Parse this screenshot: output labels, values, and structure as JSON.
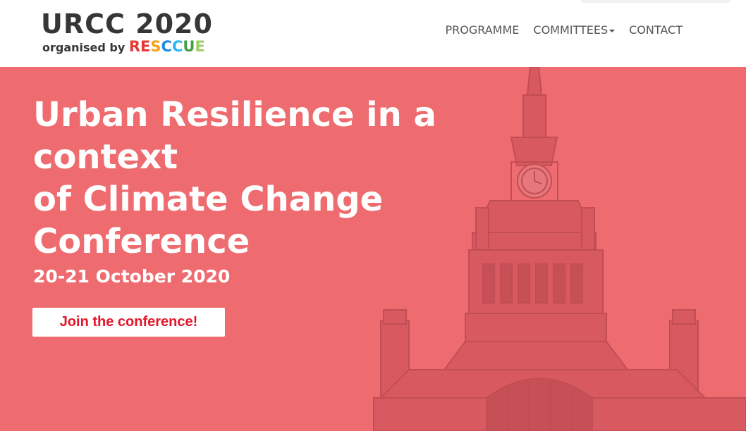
{
  "logo": {
    "title": "URCC 2020",
    "subtitle": "organised by",
    "brand_letters": [
      {
        "char": "R",
        "color": "#e53935"
      },
      {
        "char": "E",
        "color": "#e53935"
      },
      {
        "char": "S",
        "color": "#f4a21b"
      },
      {
        "char": "C",
        "color": "#1e88e5"
      },
      {
        "char": "C",
        "color": "#29b6f6"
      },
      {
        "char": "U",
        "color": "#43a047"
      },
      {
        "char": "E",
        "color": "#9ccc65"
      }
    ]
  },
  "nav": {
    "items": [
      {
        "label": "PROGRAMME",
        "has_dropdown": false
      },
      {
        "label": "COMMITTEES",
        "has_dropdown": true
      },
      {
        "label": "CONTACT",
        "has_dropdown": false
      }
    ]
  },
  "hero": {
    "title_lines": [
      "Urban Resilience in a context",
      "of Climate Change",
      "Conference"
    ],
    "date": "20-21 October 2020",
    "cta_label": "Join the conference!",
    "background_color": "#ee6c70",
    "cta_text_color": "#e3152a"
  }
}
